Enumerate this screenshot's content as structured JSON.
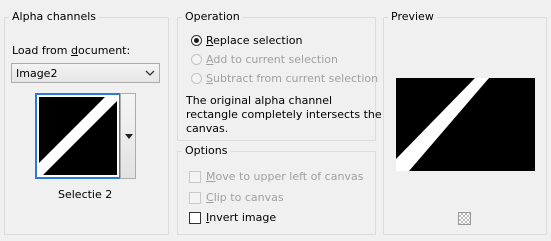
{
  "alpha_channels": {
    "title": "Alpha channels",
    "load_label_pre": "Load from ",
    "load_label_key": "d",
    "load_label_post": "ocument:",
    "document_select": {
      "value": "Image2"
    },
    "channel_name": "Selectie 2"
  },
  "operation": {
    "title": "Operation",
    "options": [
      {
        "key": "R",
        "rest": "eplace selection",
        "checked": true,
        "enabled": true
      },
      {
        "key": "A",
        "rest": "dd to current selection",
        "checked": false,
        "enabled": false
      },
      {
        "key": "S",
        "rest": "ubtract from current selection",
        "checked": false,
        "enabled": false
      }
    ],
    "info_text_lines": [
      "The original alpha channel",
      "rectangle completely intersects the",
      "canvas."
    ]
  },
  "options": {
    "title": "Options",
    "checkboxes": [
      {
        "key": "M",
        "rest": "ove to upper left of canvas",
        "checked": false,
        "enabled": false
      },
      {
        "key": "C",
        "rest": "lip to canvas",
        "checked": false,
        "enabled": false
      },
      {
        "key": "I",
        "rest": "nvert image",
        "checked": false,
        "enabled": true
      }
    ]
  },
  "preview": {
    "title": "Preview",
    "icon": "checkerboard-icon"
  },
  "colors": {
    "accent": "#2a7ad8",
    "preview_background": "#000000",
    "preview_stripe": "#ffffff",
    "disabled_text": "#a0a0a0"
  }
}
